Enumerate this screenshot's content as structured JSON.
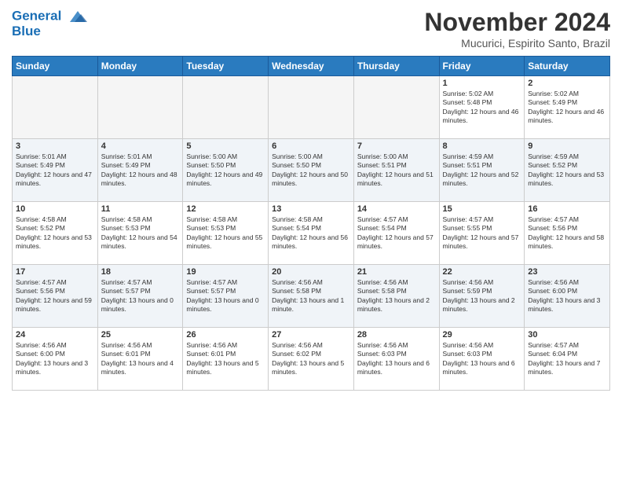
{
  "header": {
    "logo_line1": "General",
    "logo_line2": "Blue",
    "month": "November 2024",
    "location": "Mucurici, Espirito Santo, Brazil"
  },
  "weekdays": [
    "Sunday",
    "Monday",
    "Tuesday",
    "Wednesday",
    "Thursday",
    "Friday",
    "Saturday"
  ],
  "weeks": [
    [
      {
        "day": "",
        "empty": true
      },
      {
        "day": "",
        "empty": true
      },
      {
        "day": "",
        "empty": true
      },
      {
        "day": "",
        "empty": true
      },
      {
        "day": "",
        "empty": true
      },
      {
        "day": "1",
        "sunrise": "5:02 AM",
        "sunset": "5:48 PM",
        "daylight": "12 hours and 46 minutes."
      },
      {
        "day": "2",
        "sunrise": "5:02 AM",
        "sunset": "5:49 PM",
        "daylight": "12 hours and 46 minutes."
      }
    ],
    [
      {
        "day": "3",
        "sunrise": "5:01 AM",
        "sunset": "5:49 PM",
        "daylight": "12 hours and 47 minutes."
      },
      {
        "day": "4",
        "sunrise": "5:01 AM",
        "sunset": "5:49 PM",
        "daylight": "12 hours and 48 minutes."
      },
      {
        "day": "5",
        "sunrise": "5:00 AM",
        "sunset": "5:50 PM",
        "daylight": "12 hours and 49 minutes."
      },
      {
        "day": "6",
        "sunrise": "5:00 AM",
        "sunset": "5:50 PM",
        "daylight": "12 hours and 50 minutes."
      },
      {
        "day": "7",
        "sunrise": "5:00 AM",
        "sunset": "5:51 PM",
        "daylight": "12 hours and 51 minutes."
      },
      {
        "day": "8",
        "sunrise": "4:59 AM",
        "sunset": "5:51 PM",
        "daylight": "12 hours and 52 minutes."
      },
      {
        "day": "9",
        "sunrise": "4:59 AM",
        "sunset": "5:52 PM",
        "daylight": "12 hours and 53 minutes."
      }
    ],
    [
      {
        "day": "10",
        "sunrise": "4:58 AM",
        "sunset": "5:52 PM",
        "daylight": "12 hours and 53 minutes."
      },
      {
        "day": "11",
        "sunrise": "4:58 AM",
        "sunset": "5:53 PM",
        "daylight": "12 hours and 54 minutes."
      },
      {
        "day": "12",
        "sunrise": "4:58 AM",
        "sunset": "5:53 PM",
        "daylight": "12 hours and 55 minutes."
      },
      {
        "day": "13",
        "sunrise": "4:58 AM",
        "sunset": "5:54 PM",
        "daylight": "12 hours and 56 minutes."
      },
      {
        "day": "14",
        "sunrise": "4:57 AM",
        "sunset": "5:54 PM",
        "daylight": "12 hours and 57 minutes."
      },
      {
        "day": "15",
        "sunrise": "4:57 AM",
        "sunset": "5:55 PM",
        "daylight": "12 hours and 57 minutes."
      },
      {
        "day": "16",
        "sunrise": "4:57 AM",
        "sunset": "5:56 PM",
        "daylight": "12 hours and 58 minutes."
      }
    ],
    [
      {
        "day": "17",
        "sunrise": "4:57 AM",
        "sunset": "5:56 PM",
        "daylight": "12 hours and 59 minutes."
      },
      {
        "day": "18",
        "sunrise": "4:57 AM",
        "sunset": "5:57 PM",
        "daylight": "13 hours and 0 minutes."
      },
      {
        "day": "19",
        "sunrise": "4:57 AM",
        "sunset": "5:57 PM",
        "daylight": "13 hours and 0 minutes."
      },
      {
        "day": "20",
        "sunrise": "4:56 AM",
        "sunset": "5:58 PM",
        "daylight": "13 hours and 1 minute."
      },
      {
        "day": "21",
        "sunrise": "4:56 AM",
        "sunset": "5:58 PM",
        "daylight": "13 hours and 2 minutes."
      },
      {
        "day": "22",
        "sunrise": "4:56 AM",
        "sunset": "5:59 PM",
        "daylight": "13 hours and 2 minutes."
      },
      {
        "day": "23",
        "sunrise": "4:56 AM",
        "sunset": "6:00 PM",
        "daylight": "13 hours and 3 minutes."
      }
    ],
    [
      {
        "day": "24",
        "sunrise": "4:56 AM",
        "sunset": "6:00 PM",
        "daylight": "13 hours and 3 minutes."
      },
      {
        "day": "25",
        "sunrise": "4:56 AM",
        "sunset": "6:01 PM",
        "daylight": "13 hours and 4 minutes."
      },
      {
        "day": "26",
        "sunrise": "4:56 AM",
        "sunset": "6:01 PM",
        "daylight": "13 hours and 5 minutes."
      },
      {
        "day": "27",
        "sunrise": "4:56 AM",
        "sunset": "6:02 PM",
        "daylight": "13 hours and 5 minutes."
      },
      {
        "day": "28",
        "sunrise": "4:56 AM",
        "sunset": "6:03 PM",
        "daylight": "13 hours and 6 minutes."
      },
      {
        "day": "29",
        "sunrise": "4:56 AM",
        "sunset": "6:03 PM",
        "daylight": "13 hours and 6 minutes."
      },
      {
        "day": "30",
        "sunrise": "4:57 AM",
        "sunset": "6:04 PM",
        "daylight": "13 hours and 7 minutes."
      }
    ]
  ]
}
